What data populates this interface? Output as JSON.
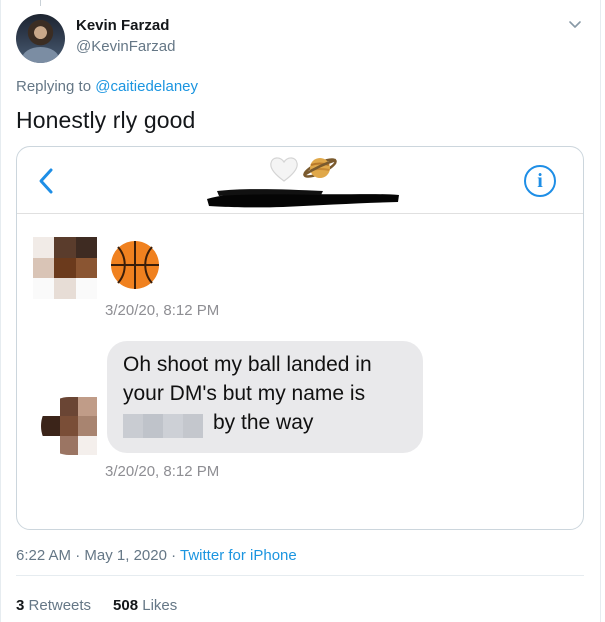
{
  "author": {
    "name": "Kevin Farzad",
    "handle": "@KevinFarzad"
  },
  "reply": {
    "prefix": "Replying to ",
    "mention": "@caitiedelaney"
  },
  "tweet_text": "Honestly rly good",
  "embedded_screenshot": {
    "header_icons": [
      "back-chevron-icon",
      "white-heart-emoji",
      "ringed-planet-emoji",
      "info-icon"
    ],
    "info_glyph": "i",
    "timestamp_1": "3/20/20, 8:12 PM",
    "timestamp_2": "3/20/20, 8:12 PM",
    "message_line_1": "Oh shoot my ball landed in",
    "message_line_2": "your DM's but my name is",
    "message_line_3": "by the way",
    "colors": {
      "accent": "#1e8ee6",
      "bubble": "#e9e9eb",
      "timestamp": "#8e8e93"
    }
  },
  "meta": {
    "time": "6:22 AM",
    "dot1": " · ",
    "date": "May 1, 2020",
    "dot2": " · ",
    "source": "Twitter for iPhone"
  },
  "stats": {
    "retweets_count": "3",
    "retweets_label": "Retweets",
    "likes_count": "508",
    "likes_label": "Likes"
  },
  "colors": {
    "link": "#1b95e0",
    "secondary_text": "#657786",
    "primary_text": "#14171a",
    "border": "#e6ecf0"
  }
}
